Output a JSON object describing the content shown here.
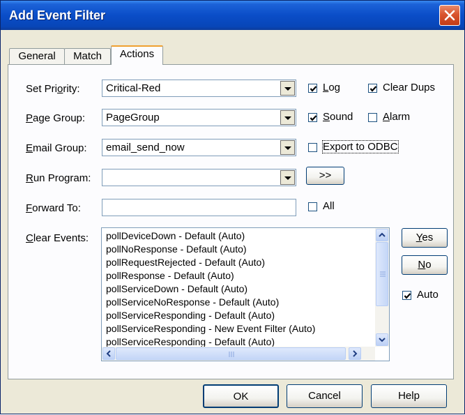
{
  "window": {
    "title": "Add Event Filter"
  },
  "tabs": [
    "General",
    "Match",
    "Actions"
  ],
  "fields": {
    "set_priority": {
      "label": "Set Priority:",
      "value": "Critical-Red"
    },
    "page_group": {
      "label": "Page Group:",
      "value": "PageGroup"
    },
    "email_group": {
      "label": "Email Group:",
      "value": "email_send_now"
    },
    "run_program": {
      "label": "Run Program:",
      "value": ""
    },
    "forward_to": {
      "label": "Forward To:",
      "value": ""
    },
    "clear_events": {
      "label": "Clear Events:"
    }
  },
  "checkboxes": {
    "log": {
      "label": "Log",
      "checked": true
    },
    "clear_dups": {
      "label": "Clear Dups",
      "checked": true
    },
    "sound": {
      "label": "Sound",
      "checked": true
    },
    "alarm": {
      "label": "Alarm",
      "checked": false
    },
    "export_odbc": {
      "label": "Export to ODBC",
      "checked": false
    },
    "all": {
      "label": "All",
      "checked": false
    },
    "auto": {
      "label": "Auto",
      "checked": true
    }
  },
  "buttons": {
    "browse": ">>",
    "yes": "Yes",
    "no": "No",
    "ok": "OK",
    "cancel": "Cancel",
    "help": "Help"
  },
  "clear_events_list": [
    "pollDeviceDown - Default (Auto)",
    "pollNoResponse - Default (Auto)",
    "pollRequestRejected - Default (Auto)",
    "pollResponse - Default (Auto)",
    "pollServiceDown - Default (Auto)",
    "pollServiceNoResponse - Default (Auto)",
    "pollServiceResponding - Default (Auto)",
    "pollServiceResponding - New Event Filter (Auto)",
    "pollServiceResponding - Default (Auto)"
  ],
  "colors": {
    "title_bar": "#0a4dc8",
    "dialog_bg": "#ece9d8",
    "close_button": "#d9542e"
  }
}
